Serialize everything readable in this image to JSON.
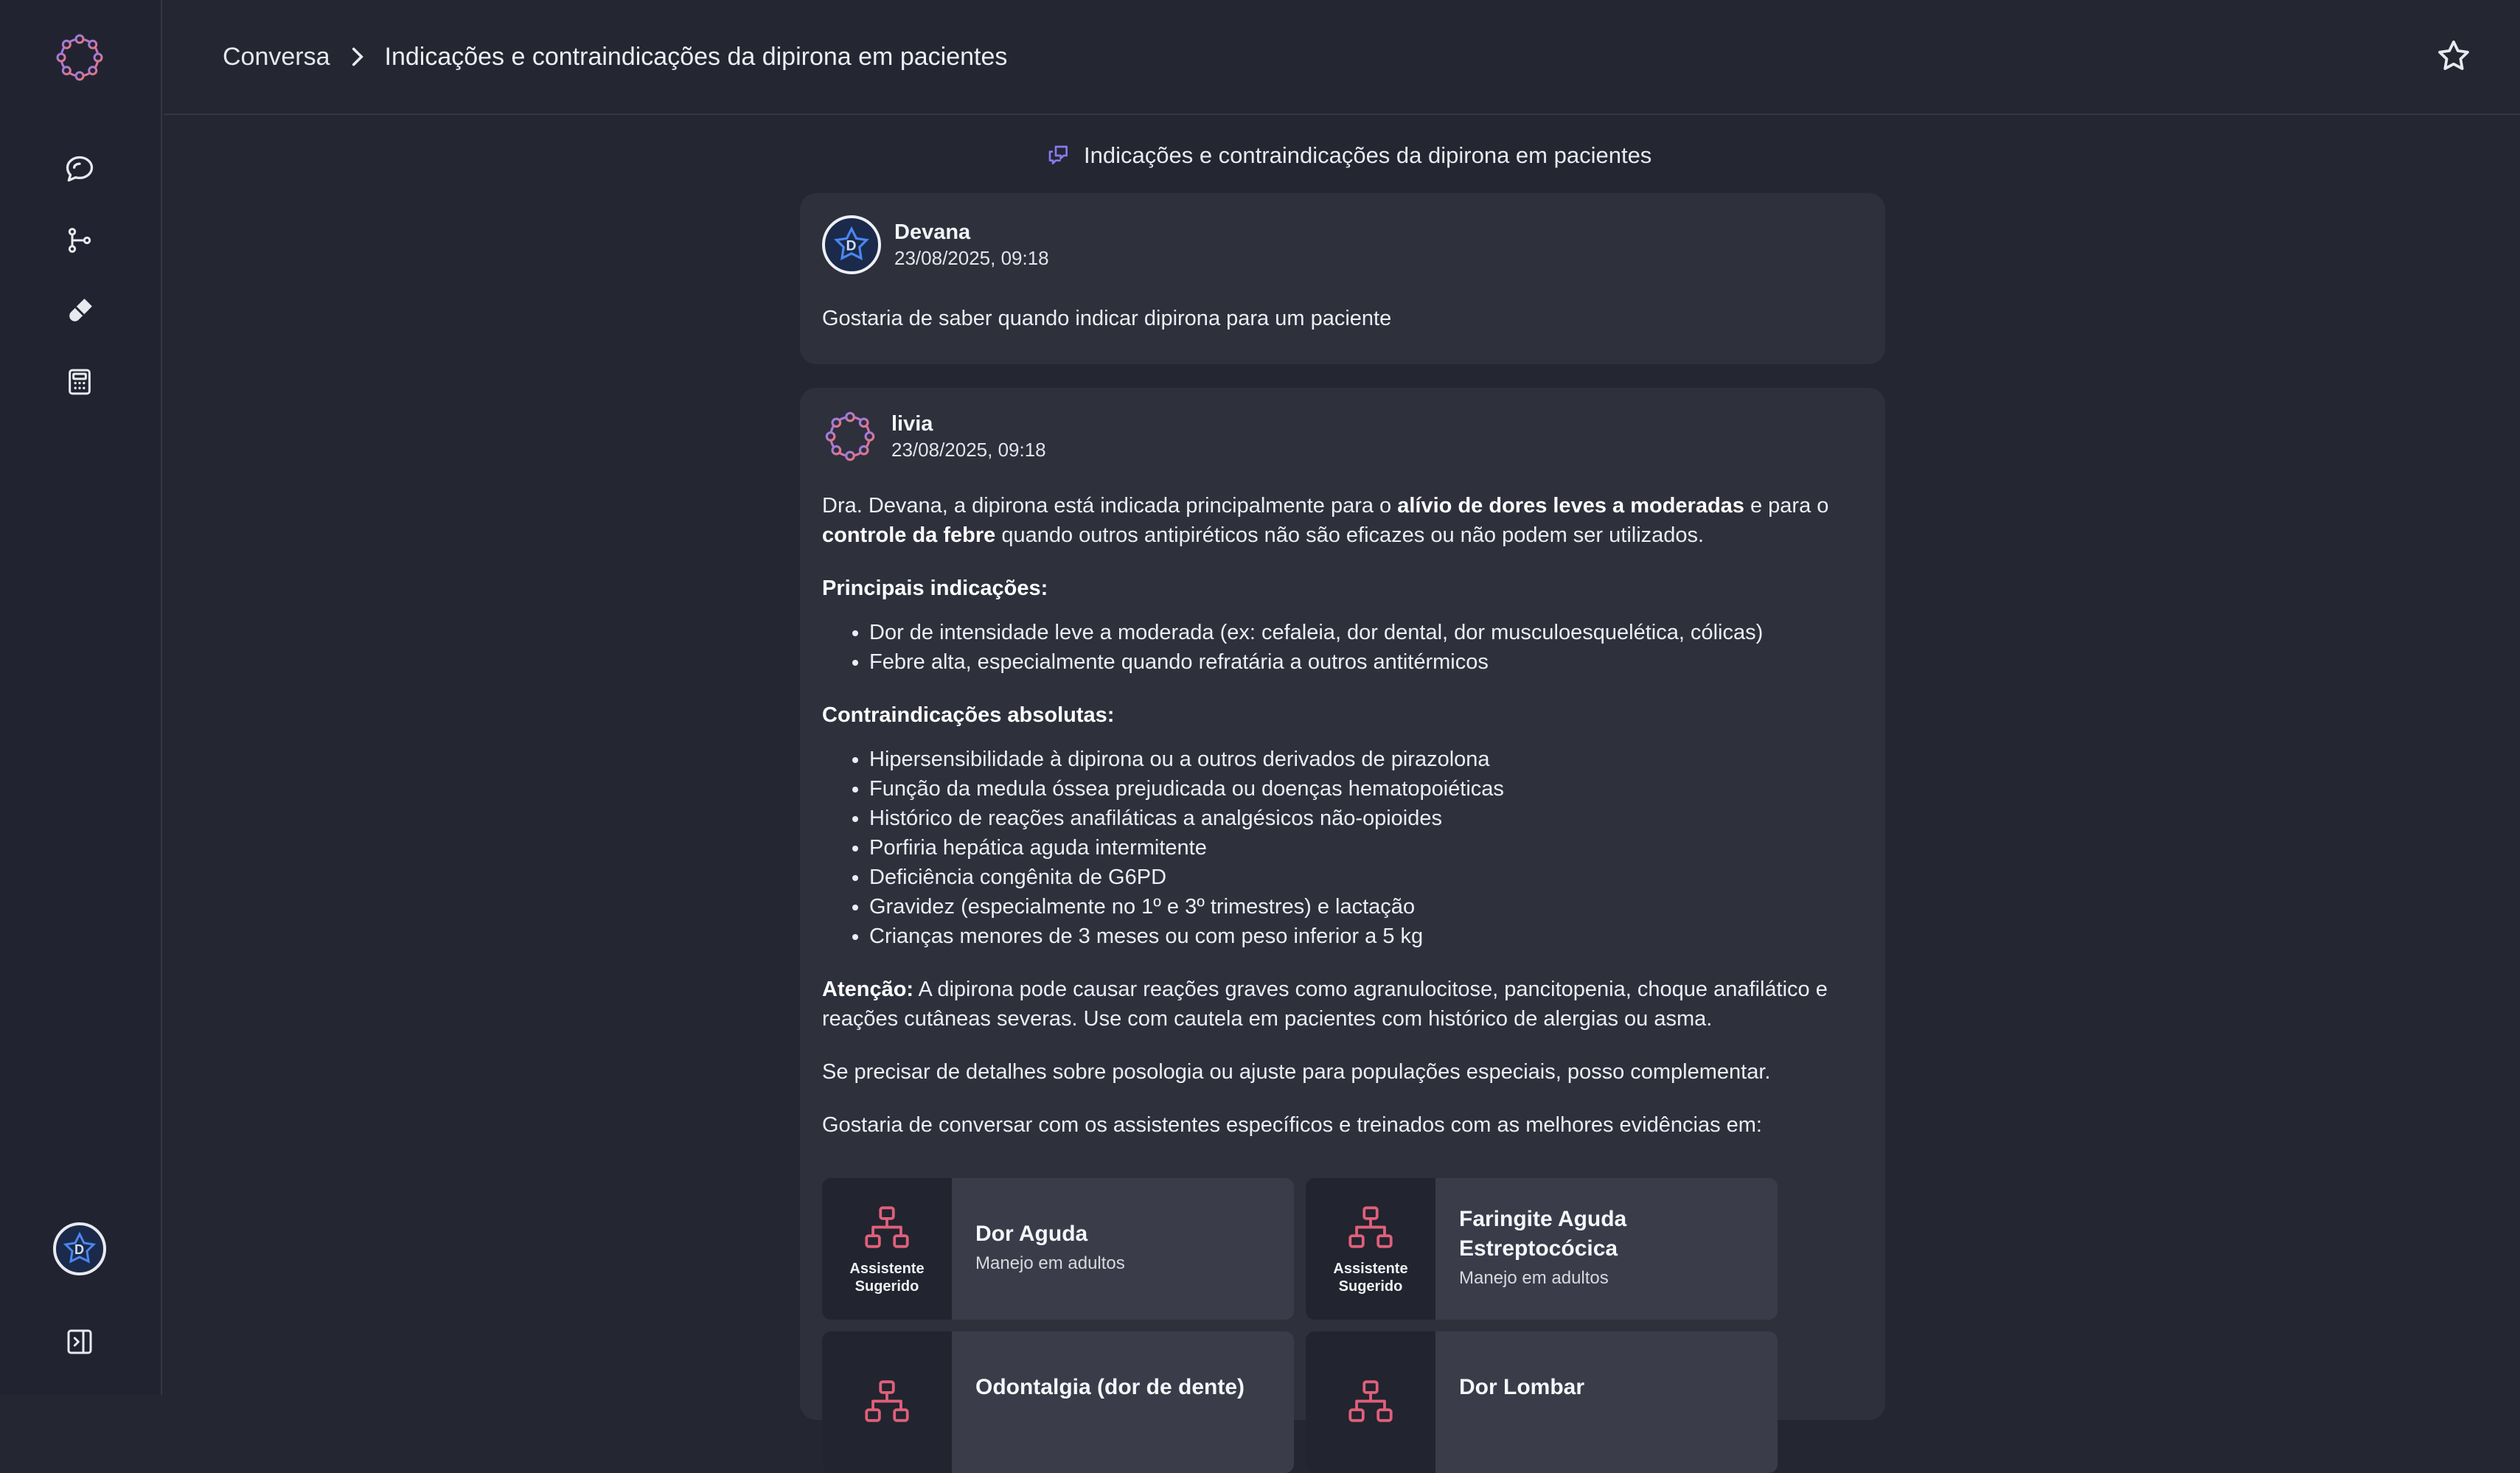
{
  "header": {
    "breadcrumb_root": "Conversa",
    "breadcrumb_current": "Indicações e contraindicações da dipirona em pacientes"
  },
  "sidebar": {
    "items": [
      {
        "icon": "chat-icon"
      },
      {
        "icon": "branch-icon"
      },
      {
        "icon": "pill-icon"
      },
      {
        "icon": "calculator-icon"
      }
    ]
  },
  "conversation": {
    "title": "Indicações e contraindicações da dipirona em pacientes"
  },
  "user_message": {
    "author": "Devana",
    "timestamp": "23/08/2025, 09:18",
    "text": "Gostaria de saber quando indicar dipirona para um paciente"
  },
  "bot_message": {
    "author": "livia",
    "timestamp": "23/08/2025, 09:18",
    "intro_1": "Dra. Devana, a dipirona está indicada principalmente para o ",
    "intro_bold_1": "alívio de dores leves a moderadas",
    "intro_2": " e para o ",
    "intro_bold_2": "controle da febre",
    "intro_3": " quando outros antipiréticos não são eficazes ou não podem ser utilizados.",
    "indications_title": "Principais indicações:",
    "indications": [
      "Dor de intensidade leve a moderada (ex: cefaleia, dor dental, dor musculoesquelética, cólicas)",
      "Febre alta, especialmente quando refratária a outros antitérmicos"
    ],
    "contra_title": "Contraindicações absolutas:",
    "contraindications": [
      "Hipersensibilidade à dipirona ou a outros derivados de pirazolona",
      "Função da medula óssea prejudicada ou doenças hematopoiéticas",
      "Histórico de reações anafiláticas a analgésicos não-opioides",
      "Porfiria hepática aguda intermitente",
      "Deficiência congênita de G6PD",
      "Gravidez (especialmente no 1º e 3º trimestres) e lactação",
      "Crianças menores de 3 meses ou com peso inferior a 5 kg"
    ],
    "attention_label": "Atenção:",
    "attention_text": " A dipirona pode causar reações graves como agranulocitose, pancitopenia, choque anafilático e reações cutâneas severas. Use com cautela em pacientes com histórico de alergias ou asma.",
    "followup": "Se precisar de detalhes sobre posologia ou ajuste para populações especiais, posso complementar.",
    "assistants_intro": "Gostaria de conversar com os assistentes específicos e treinados com as melhores evidências em:"
  },
  "assistants": {
    "badge_line1": "Assistente",
    "badge_line2": "Sugerido",
    "items": [
      {
        "title": "Dor Aguda",
        "subtitle": "Manejo em adultos"
      },
      {
        "title": "Faringite Aguda Estreptocócica",
        "subtitle": "Manejo em adultos"
      },
      {
        "title": "Odontalgia (dor de dente)",
        "subtitle": ""
      },
      {
        "title": "Dor Lombar",
        "subtitle": ""
      }
    ]
  },
  "colors": {
    "background": "#242632",
    "card": "#2e303c",
    "accent": "#e0607a",
    "avatar_ring": "#4a7be0"
  }
}
